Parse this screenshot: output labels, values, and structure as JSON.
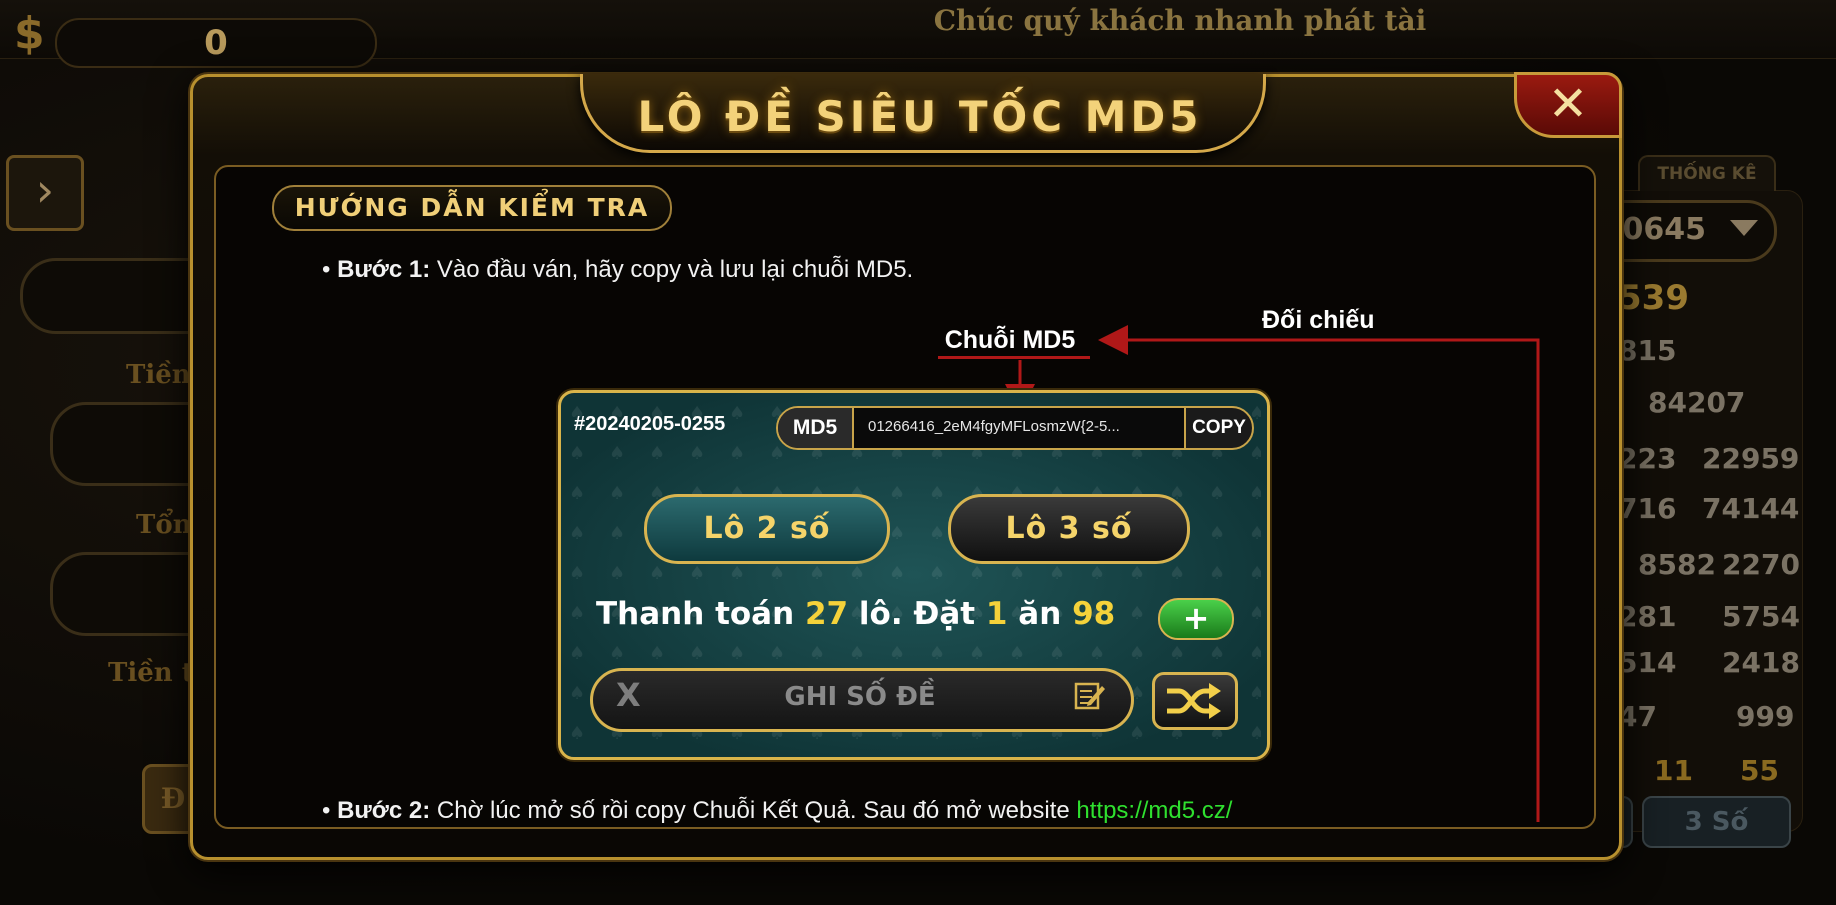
{
  "background": {
    "currency_symbol": "$",
    "balance": "0",
    "marquee": "Chúc quý khách nhanh phát tài",
    "left_labels": [
      "Tiền",
      "Tổn",
      "Tiền t"
    ],
    "left_button": "Đ",
    "right_tab": "THỐNG KÊ",
    "right_select": "-0645",
    "right_numbers": {
      "big": "539",
      "r1": "815",
      "r2": "84207",
      "r3a": "223",
      "r3b": "22959",
      "r4a": "716",
      "r4b": "74144",
      "r5a": "8582",
      "r5b": "2270",
      "r6a": "281",
      "r6b": "5754",
      "r7a": "514",
      "r7b": "2418",
      "r8a": "47",
      "r8b": "999",
      "r9a": "11",
      "r9b": "55"
    },
    "right_button": "3 Số"
  },
  "dialog": {
    "title": "LÔ ĐỀ SIÊU TỐC MD5",
    "close": "✕",
    "section": "HƯỚNG DẪN KIỂM TRA",
    "step1_label": "Bước 1:",
    "step1_text": "Vào đầu ván, hãy copy và lưu lại chuỗi MD5.",
    "label_md5": "Chuỗi MD5",
    "label_compare": "Đối chiếu",
    "step2_label": "Bước 2:",
    "step2_text": "Chờ lúc mở số rồi copy Chuỗi Kết Quả. Sau đó mở website",
    "step2_link": "https://md5.cz/"
  },
  "game": {
    "round_id": "#20240205-0255",
    "md5_tag": "MD5",
    "md5_string": "01266416_2eM4fgyMFLosmzW{2-5...",
    "copy_label": "COPY",
    "lo2_label": "Lô 2 số",
    "lo3_label": "Lô 3 số",
    "pay_text1": "Thanh toán",
    "pay_count": "27",
    "pay_text2": "lô. Đặt",
    "pay_bet": "1",
    "pay_text3": "ăn",
    "pay_win": "98",
    "plus": "+",
    "input_clear": "X",
    "input_placeholder": "GHI SỐ ĐỀ"
  },
  "colors": {
    "gold": "#f3d27a",
    "accent_green": "#2fe02f",
    "arrow_red": "#b01818",
    "table_teal": "#1f5456"
  }
}
